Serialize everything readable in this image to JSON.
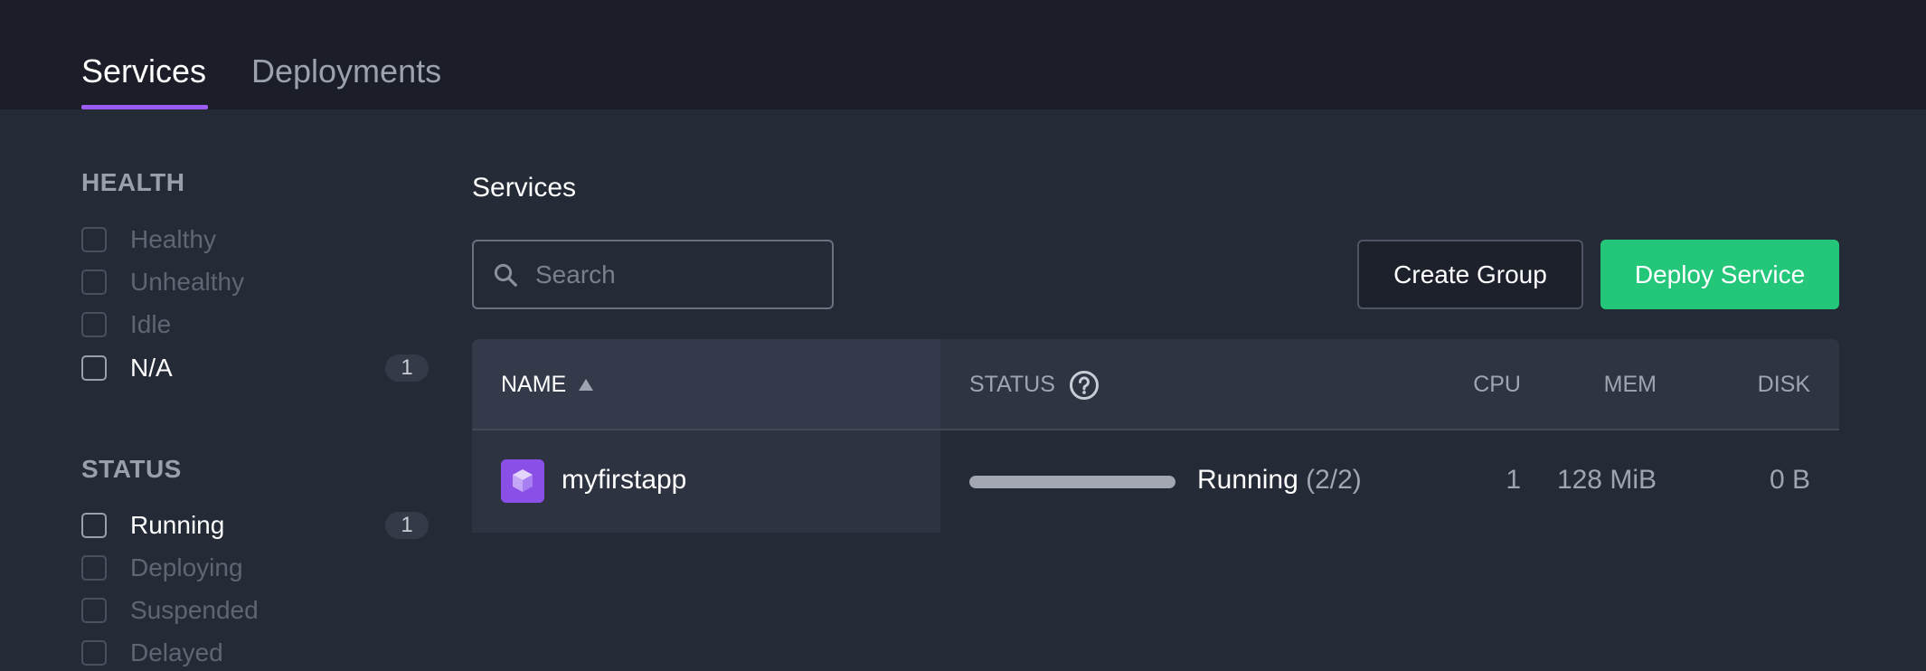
{
  "tabs": {
    "services": "Services",
    "deployments": "Deployments"
  },
  "sidebar": {
    "health": {
      "heading": "HEALTH",
      "items": [
        {
          "label": "Healthy",
          "count": ""
        },
        {
          "label": "Unhealthy",
          "count": ""
        },
        {
          "label": "Idle",
          "count": ""
        },
        {
          "label": "N/A",
          "count": "1"
        }
      ]
    },
    "status": {
      "heading": "STATUS",
      "items": [
        {
          "label": "Running",
          "count": "1"
        },
        {
          "label": "Deploying",
          "count": ""
        },
        {
          "label": "Suspended",
          "count": ""
        },
        {
          "label": "Delayed",
          "count": ""
        }
      ]
    }
  },
  "main": {
    "title": "Services",
    "search": {
      "placeholder": "Search",
      "value": ""
    },
    "buttons": {
      "create_group": "Create Group",
      "deploy_service": "Deploy Service"
    }
  },
  "table": {
    "columns": {
      "name": "NAME",
      "status": "STATUS",
      "cpu": "CPU",
      "mem": "MEM",
      "disk": "DISK"
    },
    "rows": [
      {
        "name": "myfirstapp",
        "status": "Running",
        "instances": "(2/2)",
        "progress": 1.0,
        "cpu": "1",
        "mem": "128 MiB",
        "disk": "0 B"
      }
    ]
  },
  "icons": {
    "sort": "sort-ascending-icon",
    "help": "help-circle-icon",
    "search": "search-icon",
    "app": "cube-icon"
  },
  "colors": {
    "accent": "#9b5cf4",
    "deploy_button": "#24c77a",
    "app_icon": "#8a4fe6"
  }
}
